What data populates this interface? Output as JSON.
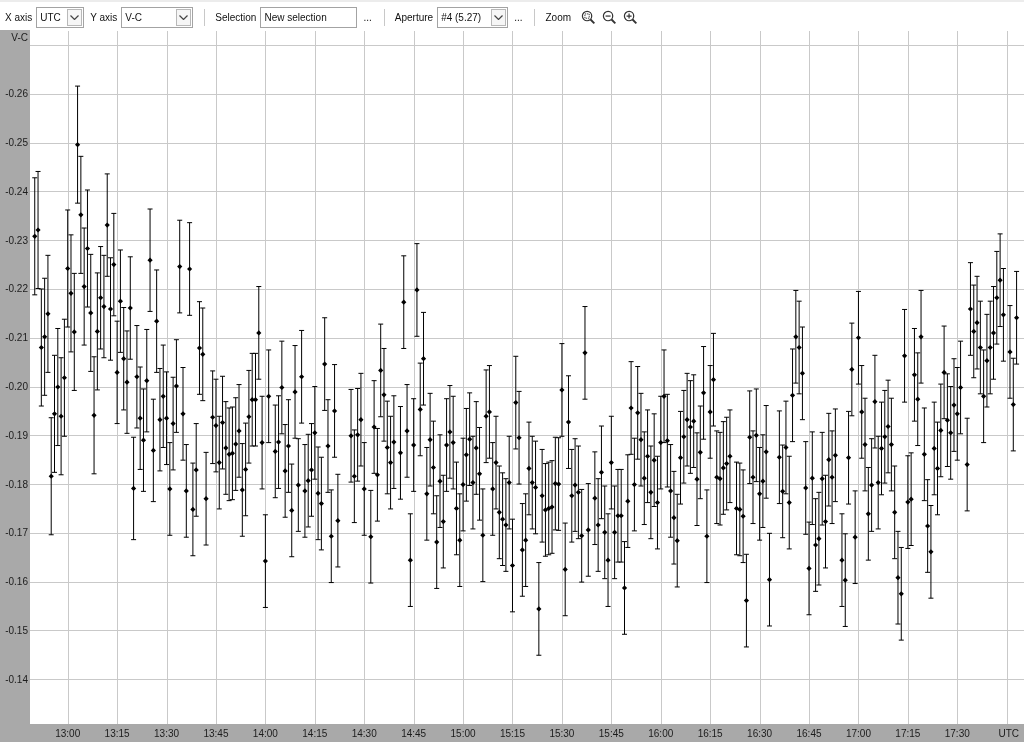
{
  "toolbar": {
    "groups": [
      {
        "items": [
          {
            "kind": "combo",
            "label": "X axis",
            "value": "UTC"
          },
          {
            "kind": "combo",
            "label": "Y axis",
            "value": "V-C"
          }
        ]
      },
      {
        "items": [
          {
            "kind": "field",
            "label": "Selection",
            "value": "New selection",
            "button": "..."
          }
        ]
      },
      {
        "items": [
          {
            "kind": "combo",
            "label": "Aperture",
            "value": "#4 (5.27)",
            "button": "..."
          }
        ]
      },
      {
        "items": [
          {
            "kind": "zoom",
            "label": "Zoom",
            "buttons": [
              {
                "kind": "fit"
              },
              {
                "kind": "out"
              },
              {
                "kind": "in"
              }
            ]
          }
        ]
      }
    ]
  },
  "chart": {
    "chart_data": {
      "type": "scatter",
      "xlabel": "UTC",
      "ylabel": "V-C",
      "grid": true,
      "ylim": [
        -0.1308,
        -0.2729
      ],
      "yticks": [
        -0.26,
        -0.25,
        -0.24,
        -0.23,
        -0.22,
        -0.21,
        {
          "value": -0.2,
          "label": "-0.20"
        },
        -0.19,
        -0.18,
        -0.17,
        -0.16,
        -0.15,
        -0.14
      ],
      "categories": [
        null,
        null,
        null,
        null,
        null,
        null,
        null,
        null,
        null,
        null,
        "13:00",
        null,
        null,
        null,
        null,
        null,
        null,
        null,
        null,
        null,
        null,
        null,
        null,
        null,
        null,
        "13:15",
        null,
        null,
        null,
        null,
        null,
        null,
        null,
        null,
        null,
        null,
        null,
        null,
        null,
        null,
        "13:30",
        null,
        null,
        null,
        null,
        null,
        null,
        null,
        null,
        null,
        null,
        null,
        null,
        null,
        null,
        "13:45",
        null,
        null,
        null,
        null,
        null,
        null,
        null,
        null,
        null,
        null,
        null,
        null,
        null,
        null,
        "14:00",
        null,
        null,
        null,
        null,
        null,
        null,
        null,
        null,
        null,
        null,
        null,
        null,
        null,
        null,
        "14:15",
        null,
        null,
        null,
        null,
        null,
        null,
        null,
        null,
        null,
        null,
        null,
        null,
        null,
        null,
        "14:30",
        null,
        null,
        null,
        null,
        null,
        null,
        null,
        null,
        null,
        null,
        null,
        null,
        null,
        null,
        "14:45",
        null,
        null,
        null,
        null,
        null,
        null,
        null,
        null,
        null,
        null,
        null,
        null,
        null,
        null,
        "15:00",
        null,
        null,
        null,
        null,
        null,
        null,
        null,
        null,
        null,
        null,
        null,
        null,
        null,
        null,
        "15:15",
        null,
        null,
        null,
        null,
        null,
        null,
        null,
        null,
        null,
        null,
        null,
        null,
        null,
        null,
        "15:30",
        null,
        null,
        null,
        null,
        null,
        null,
        null,
        null,
        null,
        null,
        null,
        null,
        null,
        null,
        "15:45",
        null,
        null,
        null,
        null,
        null,
        null,
        null,
        null,
        null,
        null,
        null,
        null,
        null,
        null,
        "16:00",
        null,
        null,
        null,
        null,
        null,
        null,
        null,
        null,
        null,
        null,
        null,
        null,
        null,
        null,
        "16:15",
        null,
        null,
        null,
        null,
        null,
        null,
        null,
        null,
        null,
        null,
        null,
        null,
        null,
        null,
        "16:30",
        null,
        null,
        null,
        null,
        null,
        null,
        null,
        null,
        null,
        null,
        null,
        null,
        null,
        null,
        "16:45",
        null,
        null,
        null,
        null,
        null,
        null,
        null,
        null,
        null,
        null,
        null,
        null,
        null,
        null,
        "17:00",
        null,
        null,
        null,
        null,
        null,
        null,
        null,
        null,
        null,
        null,
        null,
        null,
        null,
        null,
        "17:15",
        null,
        null,
        null,
        null,
        null,
        null,
        null,
        null,
        null,
        null,
        null,
        null,
        null,
        null,
        "17:30",
        null,
        null,
        null,
        null,
        null,
        null,
        null,
        null,
        null,
        null,
        null,
        null,
        null,
        null,
        null,
        null,
        null,
        null
      ],
      "series": [
        {
          "color": "#000000",
          "values": [
            -0.2308,
            -0.2321,
            -0.208,
            -0.2102,
            -0.2149,
            -0.1816,
            -0.1944,
            -0.1999,
            -0.1939,
            -0.2018,
            -0.2242,
            -0.2191,
            -0.2112,
            -0.2496,
            -0.2352,
            -0.2205,
            -0.2283,
            -0.2151,
            -0.1941,
            -0.2113,
            -0.2182,
            -0.2164,
            -0.2331,
            -0.2159,
            -0.225,
            -0.2029,
            -0.2175,
            -0.2057,
            -0.2009,
            -0.2161,
            -0.1791,
            -0.202,
            -0.1935,
            -0.189,
            -0.2012,
            -0.2259,
            -0.1869,
            -0.2134,
            -0.1932,
            -0.198,
            -0.1935,
            -0.179,
            -0.1924,
            -0.2001,
            -0.2246,
            -0.1944,
            -0.1786,
            -0.2241,
            -0.1748,
            -0.1829,
            -0.2079,
            -0.2066,
            -0.177,
            null,
            -0.1937,
            -0.192,
            -0.1844,
            -0.1926,
            -0.1874,
            -0.1861,
            -0.1863,
            -0.1882,
            -0.1909,
            -0.1788,
            -0.183,
            -0.1938,
            -0.1973,
            -0.1973,
            -0.211,
            -0.1885,
            -0.1642,
            -0.198,
            null,
            -0.1867,
            -0.1886,
            -0.1998,
            -0.1827,
            -0.1878,
            -0.1746,
            -0.1989,
            -0.1798,
            -0.202,
            -0.1786,
            -0.1807,
            -0.1829,
            -0.1905,
            -0.1781,
            -0.176,
            -0.2046,
            -0.1878,
            -0.1693,
            -0.195,
            -0.1725,
            null,
            null,
            null,
            -0.1899,
            -0.1816,
            -0.1901,
            -0.1932,
            -0.179,
            null,
            -0.1692,
            -0.1917,
            -0.1819,
            -0.2033,
            -0.1983,
            -0.1875,
            -0.1844,
            -0.1886,
            null,
            -0.1864,
            -0.2173,
            -0.1909,
            -0.1644,
            -0.188,
            -0.2198,
            -0.1953,
            -0.2057,
            -0.178,
            -0.1891,
            -0.1834,
            -0.1681,
            -0.1806,
            -0.1723,
            -0.188,
            -0.1907,
            -0.1885,
            -0.175,
            -0.1685,
            -0.1799,
            -0.186,
            -0.1892,
            -0.1803,
            -0.1874,
            -0.1821,
            -0.1695,
            -0.1939,
            -0.1948,
            -0.179,
            -0.1844,
            -0.1742,
            -0.1728,
            -0.1716,
            -0.1803,
            -0.1633,
            -0.1967,
            -0.1895,
            -0.1665,
            -0.1685,
            -0.1832,
            -0.1803,
            -0.1793,
            -0.1544,
            -0.1776,
            -0.1747,
            -0.175,
            -0.1753,
            -0.1801,
            -0.18,
            -0.1993,
            -0.1625,
            -0.1927,
            -0.1776,
            -0.1798,
            -0.1783,
            -0.1694,
            -0.2069,
            -0.1706,
            null,
            -0.1771,
            -0.1716,
            -0.1824,
            -0.1701,
            -0.1644,
            -0.1844,
            -0.1701,
            -0.1735,
            -0.1735,
            -0.1587,
            -0.1765,
            -0.1956,
            -0.1799,
            -0.1946,
            -0.1891,
            -0.1812,
            -0.1857,
            -0.1783,
            -0.1849,
            -0.1762,
            -0.1885,
            -0.198,
            -0.1889,
            -0.1786,
            -0.1731,
            -0.1684,
            -0.1854,
            -0.1897,
            -0.1932,
            -0.1917,
            -0.1929,
            -0.181,
            -0.1865,
            -0.1987,
            -0.1693,
            -0.1948,
            -0.2014,
            -0.1814,
            -0.1811,
            -0.1833,
            -0.1842,
            -0.1857,
            null,
            -0.175,
            -0.1748,
            -0.1734,
            -0.1561,
            -0.1896,
            -0.1814,
            -0.19,
            -0.178,
            -0.1806,
            -0.1866,
            -0.1604,
            null,
            null,
            -0.1855,
            -0.1785,
            -0.1875,
            -0.1762,
            -0.1982,
            -0.2102,
            -0.208,
            -0.2027,
            -0.1792,
            -0.1627,
            -0.1812,
            -0.1675,
            -0.1688,
            -0.1811,
            -0.1723,
            -0.185,
            -0.1814,
            -0.1859,
            null,
            -0.1644,
            -0.1603,
            -0.1854,
            -0.2035,
            -0.1691,
            -0.21,
            -0.1948,
            -0.1881,
            -0.1739,
            -0.1798,
            -0.1969,
            -0.1803,
            -0.1873,
            -0.1897,
            -0.1918,
            -0.1881,
            -0.1742,
            -0.1608,
            -0.1575,
            -0.2063,
            -0.1763,
            -0.1769,
            -0.2024,
            -0.1974,
            -0.2102,
            -0.1861,
            -0.1714,
            -0.1661,
            -0.1873,
            -0.1832,
            -0.191,
            -0.2029,
            -0.1931,
            -0.1905,
            -0.1962,
            -0.1944,
            -0.1998,
            null,
            -0.184,
            -0.2159,
            -0.2113,
            -0.2131,
            -0.208,
            -0.198,
            -0.2053,
            -0.208,
            -0.211,
            -0.2182,
            -0.2218,
            -0.2147,
            null,
            -0.2071,
            -0.1963,
            -0.2141
          ],
          "errors": [
            0.012,
            0.012,
            0.012,
            0.012,
            0.012,
            0.012,
            0.012,
            0.012,
            0.012,
            0.012,
            0.012,
            0.012,
            0.012,
            0.012,
            0.012,
            0.012,
            0.012,
            0.012,
            0.012,
            0.012,
            0.0105,
            0.0105,
            0.0105,
            0.0105,
            0.0105,
            0.0105,
            0.0105,
            0.0105,
            0.0105,
            0.0105,
            0.0105,
            0.0105,
            0.0105,
            0.0105,
            0.0105,
            0.0105,
            0.0105,
            0.0105,
            0.0105,
            0.0105,
            0.0095,
            0.0095,
            0.0095,
            0.0095,
            0.0095,
            0.0095,
            0.0095,
            0.0095,
            0.0095,
            0.0095,
            0.0095,
            0.0095,
            0.0095,
            null,
            0.0095,
            0.0095,
            0.0095,
            0.0095,
            0.0095,
            0.0095,
            0.0095,
            0.0095,
            0.0095,
            0.0095,
            0.0095,
            0.0095,
            0.0095,
            0.0095,
            0.0095,
            0.0095,
            0.0095,
            0.0095,
            null,
            0.0095,
            0.0095,
            0.0095,
            0.0095,
            0.0095,
            0.0095,
            0.0095,
            0.0095,
            0.0095,
            0.0095,
            0.0095,
            0.0095,
            0.0095,
            0.0095,
            0.0095,
            0.0095,
            0.0095,
            0.0095,
            0.0095,
            0.0095,
            null,
            null,
            null,
            0.0095,
            0.0095,
            0.0095,
            0.0095,
            0.0095,
            null,
            0.0095,
            0.0095,
            0.0095,
            0.0095,
            0.0095,
            0.0095,
            0.0095,
            0.0095,
            null,
            0.0095,
            0.0095,
            0.0095,
            0.0095,
            0.0095,
            0.0095,
            0.0095,
            0.0095,
            0.0095,
            0.0095,
            0.0095,
            0.0095,
            0.0095,
            0.0095,
            0.0095,
            0.0095,
            0.0095,
            0.0095,
            0.0095,
            0.0095,
            0.0095,
            0.0095,
            0.0095,
            0.0095,
            0.0095,
            0.0095,
            0.0095,
            0.0095,
            0.0095,
            0.0095,
            0.0095,
            0.0095,
            0.0095,
            0.0095,
            0.0095,
            0.0095,
            0.0095,
            0.0095,
            0.0095,
            0.0095,
            0.0095,
            0.0095,
            0.0095,
            0.0095,
            0.0095,
            0.0095,
            0.0095,
            0.0095,
            0.0095,
            0.0095,
            0.0095,
            0.0095,
            0.0095,
            0.0095,
            0.0095,
            0.0095,
            0.0095,
            0.0095,
            null,
            0.0095,
            0.0095,
            0.0095,
            0.0095,
            0.0095,
            0.0095,
            0.0095,
            0.0095,
            0.0095,
            0.0095,
            0.0095,
            0.0095,
            0.0095,
            0.0095,
            0.0095,
            0.0095,
            0.0095,
            0.0095,
            0.0095,
            0.0095,
            0.0095,
            0.0095,
            0.0095,
            0.0095,
            0.0095,
            0.0095,
            0.0095,
            0.0095,
            0.0095,
            0.0095,
            0.0095,
            0.0095,
            0.0095,
            0.0095,
            0.0095,
            0.0095,
            0.0095,
            0.0095,
            0.0095,
            0.0095,
            0.0095,
            0.0095,
            null,
            0.0095,
            0.0095,
            0.0095,
            0.0095,
            0.0095,
            0.0095,
            0.0095,
            0.0095,
            0.0095,
            0.0095,
            0.0095,
            null,
            null,
            0.0095,
            0.0095,
            0.0095,
            0.0095,
            0.0095,
            0.0095,
            0.0095,
            0.0095,
            0.0095,
            0.0095,
            0.0095,
            0.0095,
            0.0095,
            0.0095,
            0.0095,
            0.0095,
            0.0095,
            0.0095,
            null,
            0.0095,
            0.0095,
            0.0095,
            0.0095,
            0.0095,
            0.0095,
            0.0095,
            0.0095,
            0.0095,
            0.0095,
            0.0095,
            0.0095,
            0.0095,
            0.0095,
            0.0095,
            0.0095,
            0.0095,
            0.0095,
            0.0095,
            0.0095,
            0.0095,
            0.0095,
            0.0095,
            0.0095,
            0.0095,
            0.0095,
            0.0095,
            0.0095,
            0.0095,
            0.0095,
            0.0095,
            0.0095,
            0.0095,
            0.0095,
            0.0095,
            0.0095,
            0.0095,
            null,
            0.0095,
            0.0095,
            0.0095,
            0.0095,
            0.0095,
            0.0095,
            0.0095,
            0.0095,
            0.0095,
            0.0095,
            0.0095,
            0.0095,
            null,
            0.0095,
            0.0095,
            0.0095
          ]
        }
      ]
    }
  }
}
